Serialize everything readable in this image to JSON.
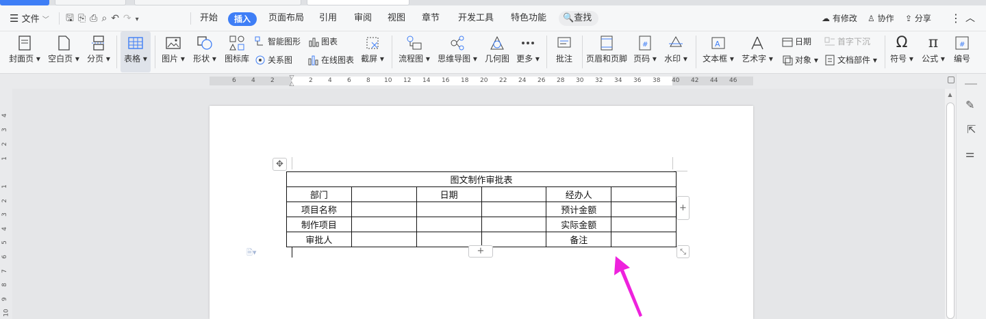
{
  "menu": {
    "file": "文件",
    "tabs": [
      "开始",
      "插入",
      "页面布局",
      "引用",
      "审阅",
      "视图",
      "章节",
      "开发工具",
      "特色功能"
    ],
    "active_tab": "插入",
    "search": "查找",
    "modified": "有修改",
    "collab": "协作",
    "share": "分享"
  },
  "ribbon": {
    "cover": "封面页",
    "blank": "空白页",
    "pagebreak": "分页",
    "table": "表格",
    "picture": "图片",
    "shape": "形状",
    "iconlib": "图标库",
    "smartart": "智能图形",
    "chart": "图表",
    "relation": "关系图",
    "onlinechart": "在线图表",
    "screenshot": "截屏",
    "flowchart": "流程图",
    "mindmap": "思维导图",
    "geometry": "几何图",
    "more": "更多",
    "comment": "批注",
    "headerfooter": "页眉和页脚",
    "pagenum": "页码",
    "watermark": "水印",
    "textbox": "文本框",
    "wordart": "艺术字",
    "date": "日期",
    "object": "对象",
    "dropcap": "首字下沉",
    "docpart": "文档部件",
    "symbol": "符号",
    "formula": "公式",
    "numbering": "编号"
  },
  "ruler": {
    "h": [
      "6",
      "4",
      "2",
      "2",
      "4",
      "6",
      "8",
      "10",
      "12",
      "14",
      "16",
      "18",
      "20",
      "22",
      "24",
      "26",
      "28",
      "30",
      "32",
      "34",
      "36",
      "38",
      "40",
      "42",
      "44",
      "46"
    ],
    "v": [
      "4",
      "3",
      "2",
      "1",
      "1",
      "2",
      "3",
      "4",
      "5",
      "6",
      "7",
      "8",
      "9",
      "10"
    ]
  },
  "table": {
    "title": "图文制作审批表",
    "rows": [
      [
        "部门",
        "",
        "日期",
        "",
        "经办人",
        ""
      ],
      [
        "项目名称",
        "",
        "",
        "",
        "预计金额",
        ""
      ],
      [
        "制作项目",
        "",
        "",
        "",
        "实际金额",
        ""
      ],
      [
        "审批人",
        "",
        "",
        "",
        "备注",
        ""
      ]
    ]
  },
  "colors": {
    "accent": "#3e7ef6",
    "arrow": "#ee22dd"
  }
}
